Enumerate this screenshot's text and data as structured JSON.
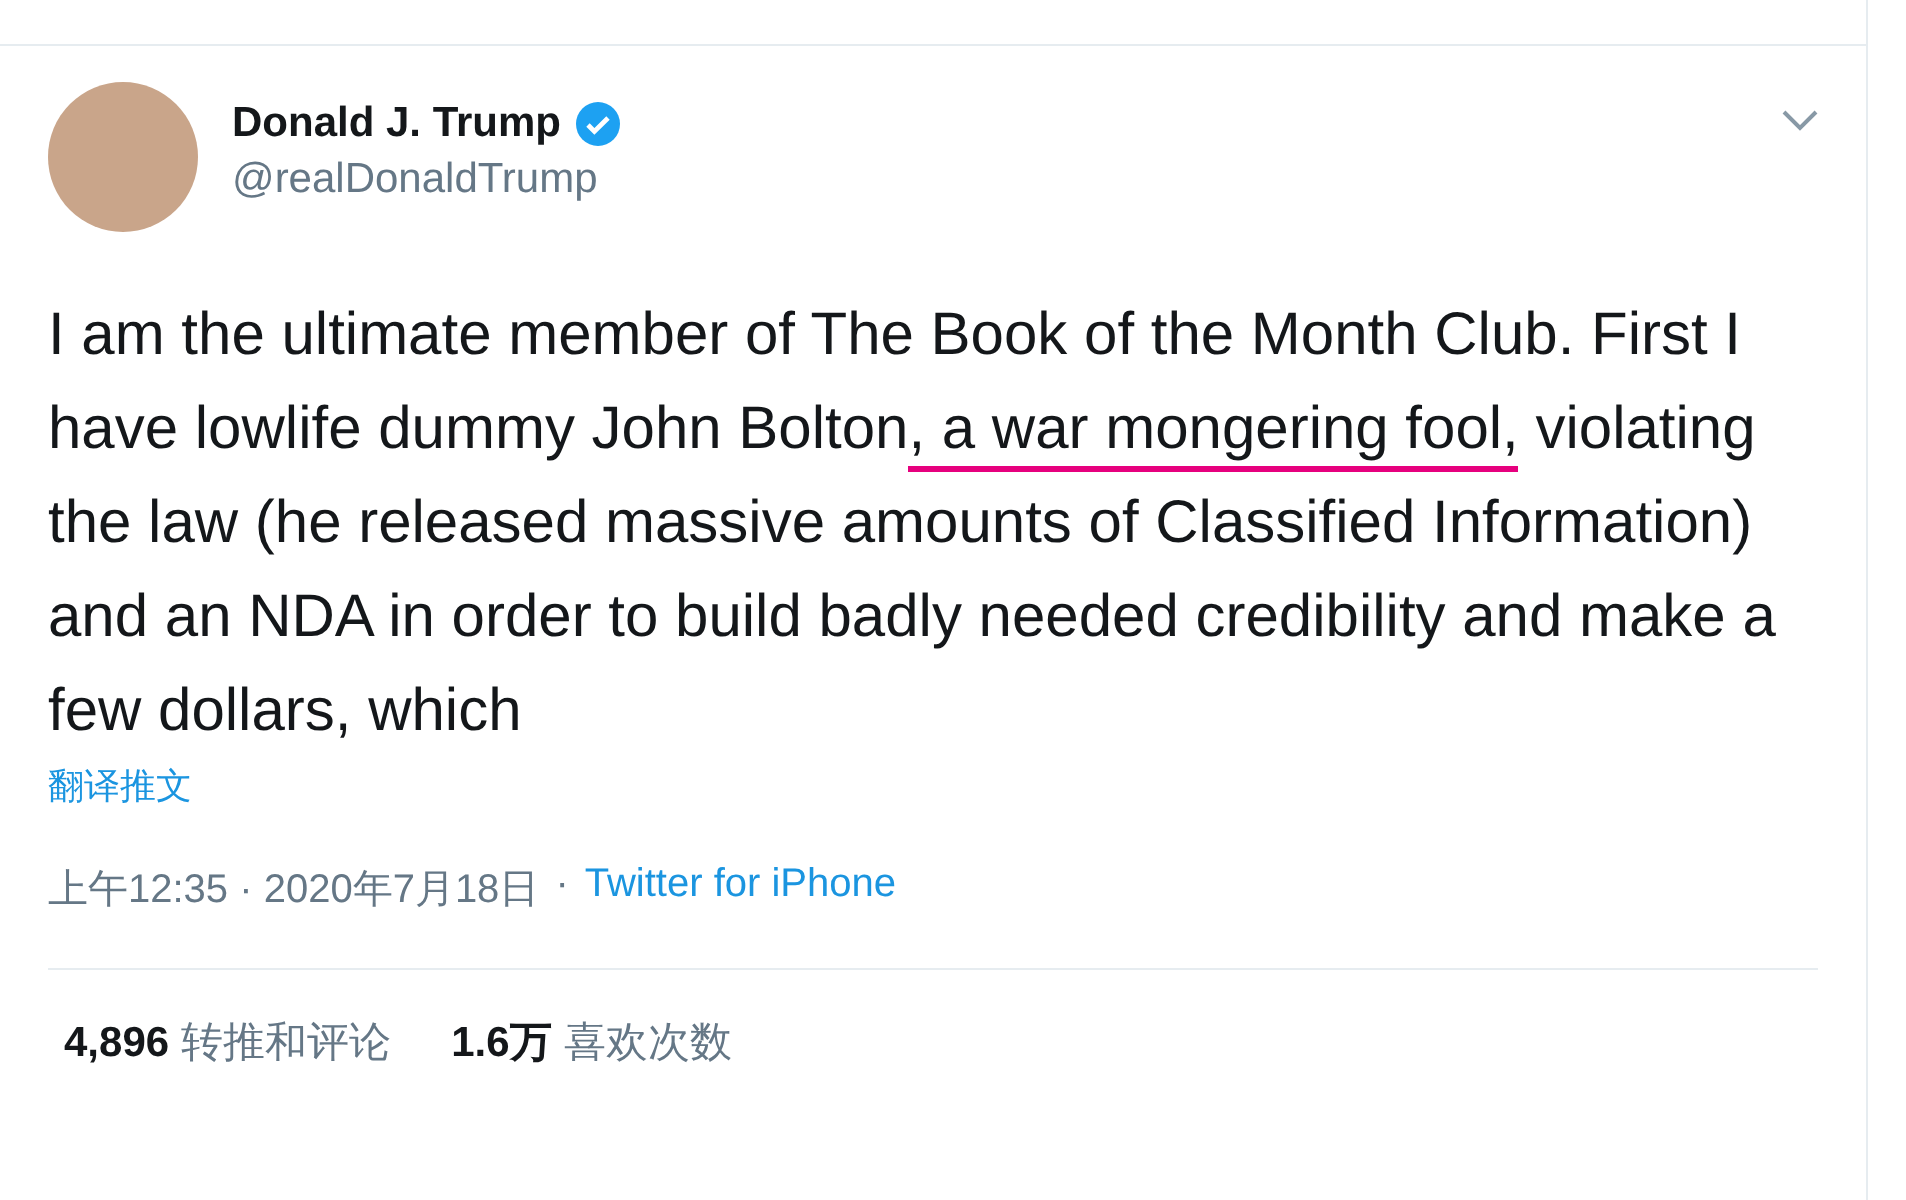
{
  "author": {
    "name": "Donald J. Trump",
    "verified": true,
    "handle": "@realDonaldTrump"
  },
  "tweet": {
    "segments": [
      {
        "text": "I am the ultimate member of The Book of the Month Club. First I have lowlife dummy John Bolton",
        "underlined": false
      },
      {
        "text": ", a war mongering fool,",
        "underlined": true
      },
      {
        "text": " violating the law (he released massive amounts of Classified Information) and an NDA in order to build badly needed credibility and make a few dollars, which",
        "underlined": false
      }
    ],
    "translate_link": "翻译推文",
    "time": "上午12:35 · 2020年7月18日",
    "separator": "·",
    "source": "Twitter for iPhone"
  },
  "stats": [
    {
      "count": "4,896",
      "label": "转推和评论"
    },
    {
      "count": "1.6万",
      "label": "喜欢次数"
    }
  ]
}
